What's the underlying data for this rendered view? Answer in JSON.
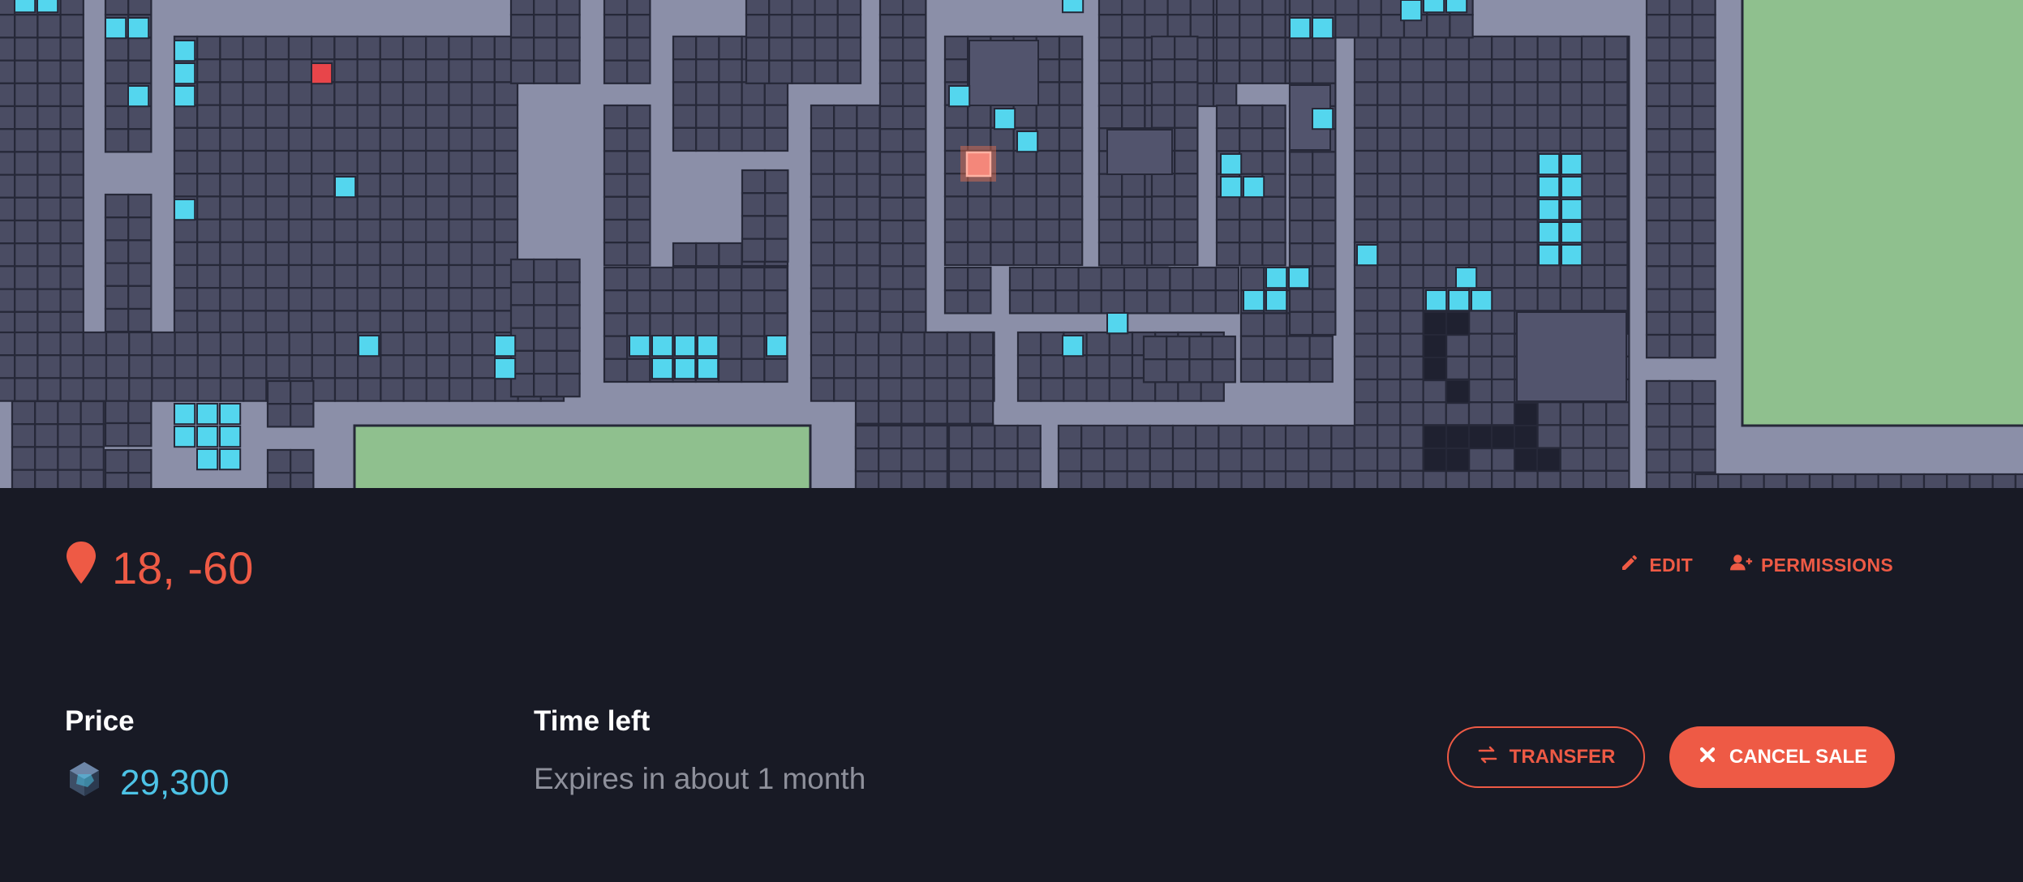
{
  "parcel": {
    "coordinates": "18, -60"
  },
  "actions": {
    "edit_label": "EDIT",
    "permissions_label": "PERMISSIONS",
    "transfer_label": "TRANSFER",
    "cancel_sale_label": "CANCEL SALE"
  },
  "sale": {
    "price_label": "Price",
    "price_value": "29,300",
    "time_left_label": "Time left",
    "time_left_value": "Expires in about 1 month"
  },
  "icons": {
    "location": "map-pin-icon",
    "edit": "pencil-icon",
    "permissions": "user-plus-icon",
    "currency": "mana-token-icon",
    "transfer": "arrows-exchange-icon",
    "cancel": "x-icon"
  },
  "colors": {
    "accent": "#ee5a45",
    "background": "#181a25",
    "price": "#4dc3e6",
    "road": "#8b8fa8",
    "parcel": "#4a4c63",
    "on_sale": "#54d6ee",
    "plaza": "#8fc08e",
    "selected": "#f4877a"
  }
}
